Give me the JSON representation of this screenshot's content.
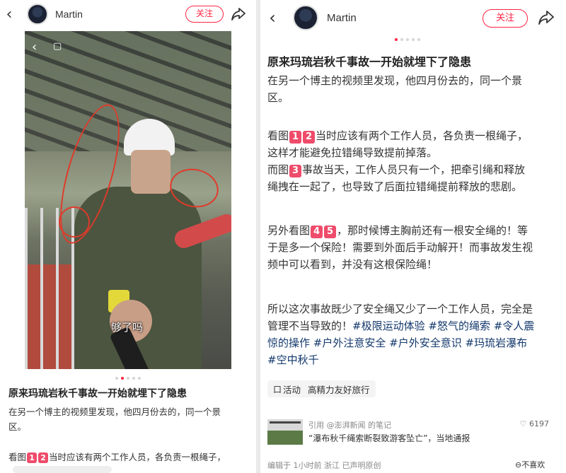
{
  "left": {
    "username": "Martin",
    "follow_label": "关注",
    "caption": "够了吗",
    "title": "原来玛琉岩秋千事故一开始就埋下了隐患",
    "p1_line1": "在另一个博主的视频里发现，他四月份去的，同一个景",
    "p1_line2": "区。",
    "p2_a": "看图",
    "n1": "1",
    "n2": "2",
    "p2_b": "当时应该有两个工作人员，各负责一根绳子，"
  },
  "right": {
    "username": "Martin",
    "follow_label": "关注",
    "title": "原来玛琉岩秋千事故一开始就埋下了隐患",
    "p1_line1": "在另一个博主的视频里发现，他四月份去的，同一个景",
    "p1_line2": "区。",
    "p2_a": "看图",
    "n1": "1",
    "n2": "2",
    "p2_b": "当时应该有两个工作人员，各负责一根绳子，",
    "p2_line2": "这样才能避免拉错绳导致提前掉落。",
    "p3_a": "而图",
    "n3": "3",
    "p3_b": "事故当天，工作人员只有一个，把牵引绳和释放",
    "p3_line2": "绳拽在一起了，也导致了后面拉错绳提前释放的悲剧。",
    "p4_a": "另外看图",
    "n4": "4",
    "n5": "5",
    "p4_b": "，那时候博主胸前还有一根安全绳的！等",
    "p4_line2": "于是多一个保险！需要到外面后手动解开！而事故发生视",
    "p4_line3": "频中可以看到，并没有这根保险绳！",
    "p5_line1": "所以这次事故既少了安全绳又少了一个工作人员，完全是",
    "p5_line2a": "管理不当导致的！",
    "tag1": "#极限运动体验",
    "tag2": "#怒气的绳索",
    "tag3a": "#令人震",
    "tag3b": "惊的操作",
    "tag4": "#户外注意安全",
    "tag5": "#户外安全意识",
    "tag6": "#玛琉岩瀑布",
    "tag7": "#空中秋千",
    "activity_icon": "口",
    "activity_label": "活动",
    "activity_text": "高精力友好旅行",
    "ref_source": "引用 @澎湃新闻 的笔记",
    "ref_title": "“瀑布秋千绳索断裂致游客坠亡”，当地通报",
    "ref_likes": "♡ 6197",
    "footer": "编辑于 1小时前 浙江 已声明原创",
    "dislike": "⊖不喜欢"
  },
  "icons": {
    "back": "chevron-left-icon",
    "share": "share-arrow-icon"
  },
  "colors": {
    "accent": "#ff2442",
    "number_badge": "#ef4b6a",
    "hashtag": "#13386c"
  }
}
